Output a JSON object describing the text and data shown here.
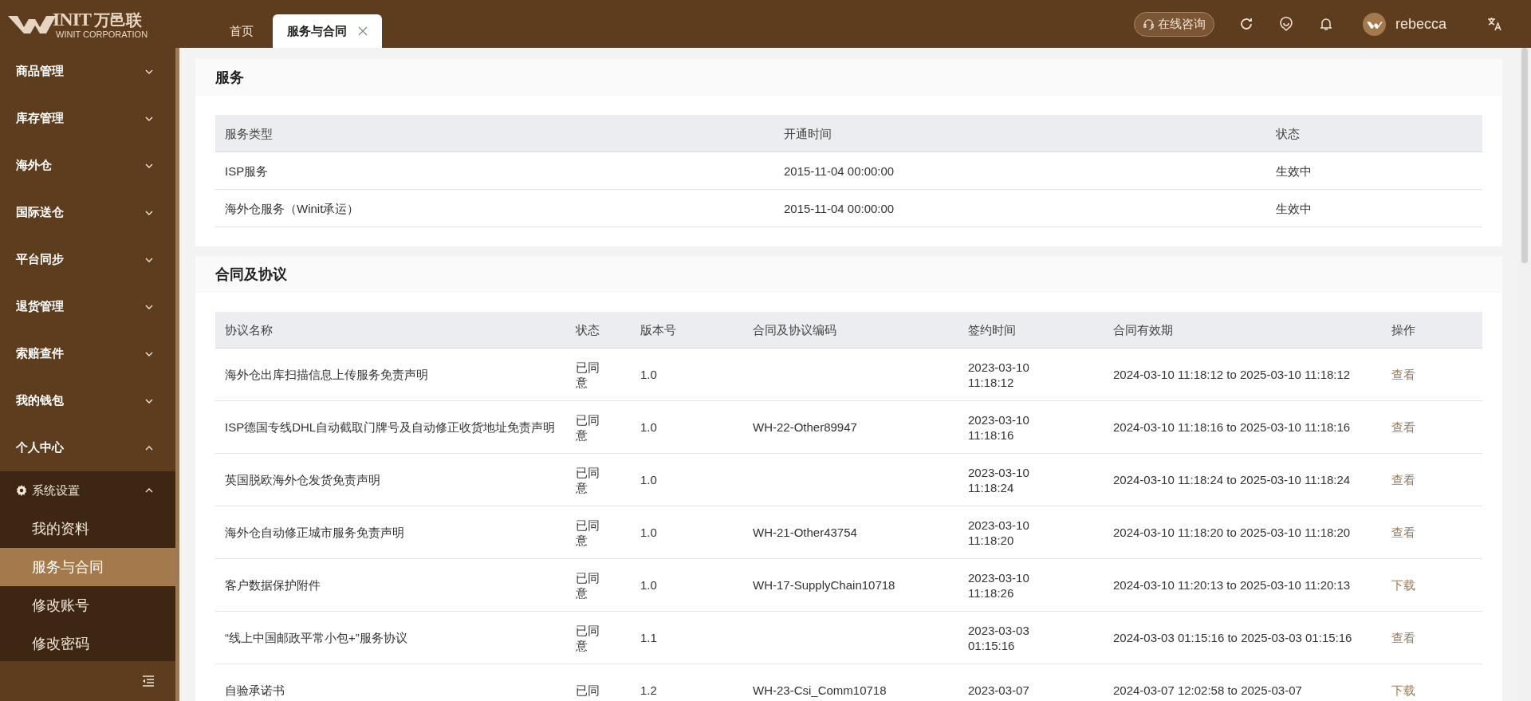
{
  "header": {
    "logo": {
      "word": "INIT",
      "name": "万邑联",
      "sub": "WINIT CORPORATION"
    },
    "tabs": [
      {
        "label": "首页",
        "selected": false,
        "closable": false
      },
      {
        "label": "服务与合同",
        "selected": true,
        "closable": true
      }
    ],
    "consult_button": "在线咨询",
    "user": "rebecca"
  },
  "sidebar": {
    "items": [
      {
        "label": "商品管理",
        "expanded": false
      },
      {
        "label": "库存管理",
        "expanded": false
      },
      {
        "label": "海外仓",
        "expanded": false
      },
      {
        "label": "国际送仓",
        "expanded": false
      },
      {
        "label": "平台同步",
        "expanded": false
      },
      {
        "label": "退货管理",
        "expanded": false
      },
      {
        "label": "索赔查件",
        "expanded": false
      },
      {
        "label": "我的钱包",
        "expanded": false
      },
      {
        "label": "个人中心",
        "expanded": true,
        "children": [
          {
            "label": "系统设置",
            "expanded": true,
            "children": [
              {
                "label": "我的资料",
                "selected": false
              },
              {
                "label": "服务与合同",
                "selected": true
              },
              {
                "label": "修改账号",
                "selected": false
              },
              {
                "label": "修改密码",
                "selected": false
              }
            ]
          }
        ]
      }
    ]
  },
  "services": {
    "title": "服务",
    "columns": [
      "服务类型",
      "开通时间",
      "状态"
    ],
    "rows": [
      [
        "ISP服务",
        "2015-11-04 00:00:00",
        "生效中"
      ],
      [
        "海外仓服务（Winit承运）",
        "2015-11-04 00:00:00",
        "生效中"
      ]
    ]
  },
  "contracts": {
    "title": "合同及协议",
    "columns": [
      "协议名称",
      "状态",
      "版本号",
      "合同及协议编码",
      "签约时间",
      "合同有效期",
      "操作"
    ],
    "rows": [
      {
        "cells": [
          "海外仓出库扫描信息上传服务免责声明",
          "已同意",
          "1.0",
          "",
          "2023-03-10 11:18:12",
          "2024-03-10 11:18:12 to 2025-03-10 11:18:12"
        ],
        "action": "查看"
      },
      {
        "cells": [
          "ISP德国专线DHL自动截取门牌号及自动修正收货地址免责声明",
          "已同意",
          "1.0",
          "WH-22-Other89947",
          "2023-03-10 11:18:16",
          "2024-03-10 11:18:16 to 2025-03-10 11:18:16"
        ],
        "action": "查看"
      },
      {
        "cells": [
          "英国脱欧海外仓发货免责声明",
          "已同意",
          "1.0",
          "",
          "2023-03-10 11:18:24",
          "2024-03-10 11:18:24 to 2025-03-10 11:18:24"
        ],
        "action": "查看"
      },
      {
        "cells": [
          "海外仓自动修正城市服务免责声明",
          "已同意",
          "1.0",
          "WH-21-Other43754",
          "2023-03-10 11:18:20",
          "2024-03-10 11:18:20 to 2025-03-10 11:18:20"
        ],
        "action": "查看"
      },
      {
        "cells": [
          "客户数据保护附件",
          "已同意",
          "1.0",
          "WH-17-SupplyChain10718",
          "2023-03-10 11:18:26",
          "2024-03-10 11:20:13 to 2025-03-10 11:20:13"
        ],
        "action": "下载"
      },
      {
        "cells": [
          "“线上中国邮政平常小包+”服务协议",
          "已同意",
          "1.1",
          "",
          "2023-03-03 01:15:16",
          "2024-03-03 01:15:16 to 2025-03-03 01:15:16"
        ],
        "action": "查看"
      },
      {
        "cells": [
          "自验承诺书",
          "已同",
          "1.2",
          "WH-23-Csi_Comm10718",
          "2023-03-07",
          "2024-03-07 12:02:58 to 2025-03-07"
        ],
        "action": "下载"
      }
    ]
  }
}
